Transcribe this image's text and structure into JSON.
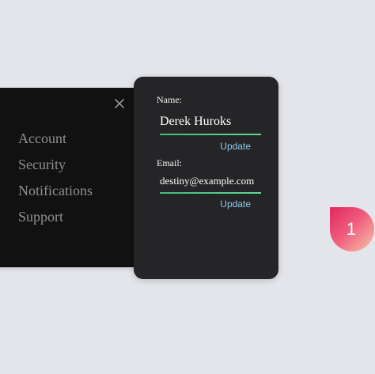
{
  "menu": {
    "close_icon": "close-icon",
    "items": [
      {
        "label": "Account"
      },
      {
        "label": "Security"
      },
      {
        "label": "Notifications"
      },
      {
        "label": "Support"
      }
    ]
  },
  "form": {
    "name": {
      "label": "Name:",
      "value": "Derek Huroks",
      "update_label": "Update"
    },
    "email": {
      "label": "Email:",
      "value": "destiny@example.com",
      "update_label": "Update"
    }
  },
  "badge": {
    "value": "1"
  },
  "colors": {
    "background": "#e3e5ea",
    "menu_panel": "#111112",
    "card": "#252527",
    "accent_green": "#4cc884",
    "link_blue": "#8ec9ee",
    "badge_start": "#e2285e",
    "badge_end": "#f7c6a8"
  }
}
